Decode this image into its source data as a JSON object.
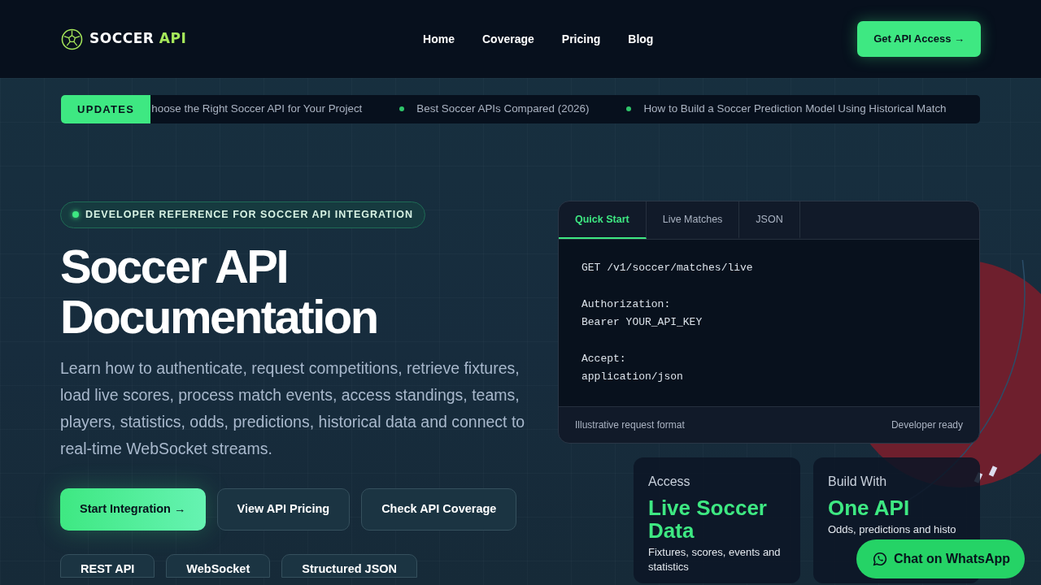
{
  "brand": {
    "name": "SOCCER",
    "accent": "API"
  },
  "nav": [
    {
      "label": "Home"
    },
    {
      "label": "Coverage"
    },
    {
      "label": "Pricing"
    },
    {
      "label": "Blog"
    }
  ],
  "cta": "Get API Access →",
  "ticker": {
    "label": "UPDATES",
    "items": [
      "hoose the Right Soccer API for Your Project",
      "Best Soccer APIs Compared (2026)",
      "How to Build a Soccer Prediction Model Using Historical Match"
    ]
  },
  "hero": {
    "badge": "DEVELOPER REFERENCE FOR SOCCER API INTEGRATION",
    "title_lines": [
      "Soccer API",
      "Documentation"
    ],
    "lead": "Learn how to authenticate, request competitions, retrieve fixtures, load live scores, process match events, access standings, teams, players, statistics, odds, predictions, historical data and connect to real-time WebSocket streams.",
    "buttons": [
      {
        "label": "Start Integration →",
        "kind": "primary"
      },
      {
        "label": "View API Pricing",
        "kind": "outline"
      },
      {
        "label": "Check API Coverage",
        "kind": "outline"
      }
    ],
    "chips": [
      "REST API",
      "WebSocket",
      "Structured JSON"
    ]
  },
  "code_panel": {
    "tabs": [
      {
        "label": "Quick Start",
        "selected": true
      },
      {
        "label": "Live Matches",
        "selected": false
      },
      {
        "label": "JSON",
        "selected": false
      }
    ],
    "blocks": [
      [
        "GET /v1/soccer/matches/live"
      ],
      [
        "Authorization:",
        "Bearer YOUR_API_KEY"
      ],
      [
        "Accept:",
        "application/json"
      ]
    ],
    "footer_left": "Illustrative request format",
    "footer_right": "Developer ready"
  },
  "stat_cards": [
    {
      "kicker": "Access",
      "headline": "Live Soccer Data",
      "text": "Fixtures, scores, events and statistics"
    },
    {
      "kicker": "Build With",
      "headline": "One API",
      "text": "Odds, predictions and histo"
    }
  ],
  "whatsapp": {
    "label": "Chat on WhatsApp"
  }
}
